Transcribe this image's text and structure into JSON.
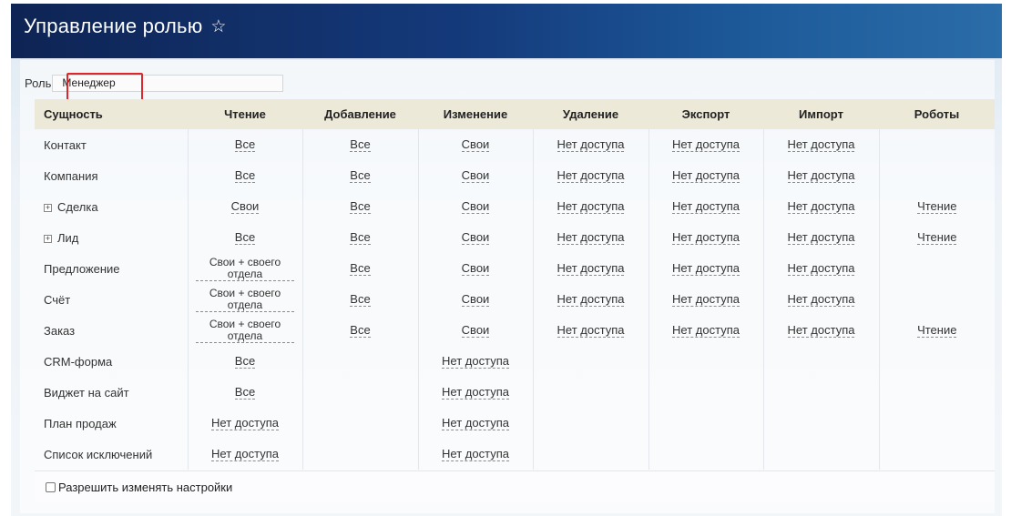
{
  "header": {
    "title": "Управление ролью"
  },
  "role": {
    "label": "Роль",
    "value": "Менеджер"
  },
  "columns": [
    "Сущность",
    "Чтение",
    "Добавление",
    "Изменение",
    "Удаление",
    "Экспорт",
    "Импорт",
    "Роботы"
  ],
  "rows": [
    {
      "entity": "Контакт",
      "expandable": false,
      "cells": [
        "Все",
        "Все",
        "Свои",
        "Нет доступа",
        "Нет доступа",
        "Нет доступа",
        ""
      ]
    },
    {
      "entity": "Компания",
      "expandable": false,
      "cells": [
        "Все",
        "Все",
        "Свои",
        "Нет доступа",
        "Нет доступа",
        "Нет доступа",
        ""
      ]
    },
    {
      "entity": "Сделка",
      "expandable": true,
      "cells": [
        "Свои",
        "Все",
        "Свои",
        "Нет доступа",
        "Нет доступа",
        "Нет доступа",
        "Чтение"
      ]
    },
    {
      "entity": "Лид",
      "expandable": true,
      "cells": [
        "Все",
        "Все",
        "Свои",
        "Нет доступа",
        "Нет доступа",
        "Нет доступа",
        "Чтение"
      ]
    },
    {
      "entity": "Предложение",
      "expandable": false,
      "cells": [
        "Свои + своего отдела",
        "Все",
        "Свои",
        "Нет доступа",
        "Нет доступа",
        "Нет доступа",
        ""
      ]
    },
    {
      "entity": "Счёт",
      "expandable": false,
      "cells": [
        "Свои + своего отдела",
        "Все",
        "Свои",
        "Нет доступа",
        "Нет доступа",
        "Нет доступа",
        ""
      ]
    },
    {
      "entity": "Заказ",
      "expandable": false,
      "cells": [
        "Свои + своего отдела",
        "Все",
        "Свои",
        "Нет доступа",
        "Нет доступа",
        "Нет доступа",
        "Чтение"
      ]
    },
    {
      "entity": "CRM-форма",
      "expandable": false,
      "cells": [
        "Все",
        "",
        "Нет доступа",
        "",
        "",
        "",
        ""
      ]
    },
    {
      "entity": "Виджет на сайт",
      "expandable": false,
      "cells": [
        "Все",
        "",
        "Нет доступа",
        "",
        "",
        "",
        ""
      ]
    },
    {
      "entity": "План продаж",
      "expandable": false,
      "cells": [
        "Нет доступа",
        "",
        "Нет доступа",
        "",
        "",
        "",
        ""
      ]
    },
    {
      "entity": "Список исключений",
      "expandable": false,
      "cells": [
        "Нет доступа",
        "",
        "Нет доступа",
        "",
        "",
        "",
        ""
      ]
    }
  ],
  "footer": {
    "checkbox_label": "Разрешить изменять настройки",
    "checked": false
  },
  "icons": {
    "favorite": "star-outline-icon",
    "expand": "plus-box-icon"
  },
  "colors": {
    "header_bg": "#14397a",
    "table_header_bg": "#ece9d9",
    "highlight": "#e0262b"
  }
}
